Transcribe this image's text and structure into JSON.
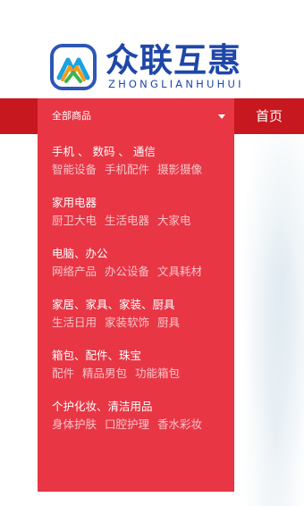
{
  "brand": {
    "name": "众联互惠",
    "pinyin": "ZHONGLIANHUHUI"
  },
  "colors": {
    "nav_red": "#c7171f",
    "panel_red": "#e83645",
    "brand_blue": "#1f47a8",
    "sub_text_pink": "#f7c3c8"
  },
  "nav": {
    "all_categories_label": "全部商品",
    "dropdown_icon": "caret-down-icon",
    "home_label": "首页"
  },
  "categories": [
    {
      "title": "手机 、 数码 、 通信",
      "subs": [
        "智能设备",
        "手机配件",
        "摄影摄像"
      ]
    },
    {
      "title": "家用电器",
      "subs": [
        "厨卫大电",
        "生活电器",
        "大家电"
      ]
    },
    {
      "title": "电脑、办公",
      "subs": [
        "网络产品",
        "办公设备",
        "文具耗材"
      ]
    },
    {
      "title": "家居、家具、家装、厨具",
      "subs": [
        "生活日用",
        "家装软饰",
        "厨具"
      ]
    },
    {
      "title": "箱包、配件、珠宝",
      "subs": [
        "配件",
        "精品男包",
        "功能箱包"
      ]
    },
    {
      "title": "个护化妆、清洁用品",
      "subs": [
        "身体护肤",
        "口腔护理",
        "香水彩妆"
      ]
    }
  ]
}
